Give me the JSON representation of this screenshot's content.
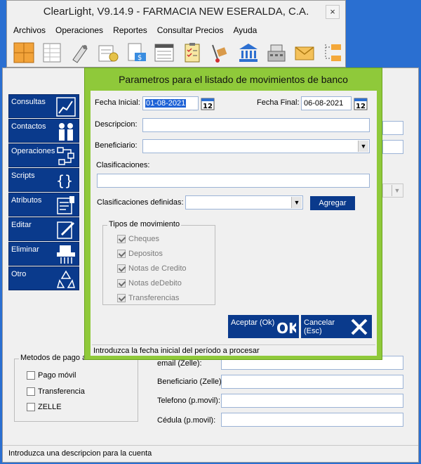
{
  "app": {
    "title": "ClearLight, V9.14.9 - FARMACIA NEW ESERALDA, C.A.",
    "close": "×",
    "menu": [
      "Archivos",
      "Operaciones",
      "Reportes",
      "Consultar Precios",
      "Ayuda"
    ],
    "toolbar_icons": [
      "grid-orange-icon",
      "spreadsheet-icon",
      "pen-icon",
      "ledger-icon",
      "invoice-dollar-icon",
      "document-list-icon",
      "checklist-icon",
      "hand-truck-icon",
      "bank-icon",
      "cash-register-icon",
      "envelope-icon",
      "folders-icon"
    ]
  },
  "background_form": {
    "side_menu": [
      {
        "label": "Consultas",
        "icon": "chart-icon"
      },
      {
        "label": "Contactos",
        "icon": "people-icon"
      },
      {
        "label": "Operaciones",
        "icon": "flow-icon"
      },
      {
        "label": "Scripts",
        "icon": "braces-icon"
      },
      {
        "label": "Atributos",
        "icon": "attributes-icon"
      },
      {
        "label": "Editar",
        "icon": "edit-icon"
      },
      {
        "label": "Eliminar",
        "icon": "shredder-icon"
      },
      {
        "label": "Otro",
        "icon": "recycle-icon"
      }
    ],
    "metodos": {
      "legend": "Metodos de pago a",
      "options": [
        "Pago móvil",
        "Transferencia",
        "ZELLE"
      ]
    },
    "labels": {
      "email": "email (Zelle):",
      "beneficiario": "Beneficiario (Zelle):",
      "telefono": "Telefono (p.movil):",
      "cedula": "Cédula (p.movil):"
    },
    "status": "Introduzca una descripcion para la cuenta"
  },
  "dialog": {
    "title": "Parametros para el listado de movimientos de banco",
    "fecha_inicial_label": "Fecha Inicial:",
    "fecha_inicial_value": "01-08-2021",
    "fecha_final_label": "Fecha Final:",
    "fecha_final_value": "06-08-2021",
    "calendar_day": "12",
    "descripcion_label": "Descripcion:",
    "descripcion_value": "",
    "beneficiario_label": "Beneficiario:",
    "beneficiario_value": "",
    "clasificaciones_label": "Clasificaciones:",
    "clasificaciones_value": "",
    "clasificaciones_definidas_label": "Clasificaciones definidas:",
    "clasificaciones_definidas_value": "",
    "agregar_label": "Agregar",
    "tipos": {
      "legend": "Tipos de movimiento",
      "items": [
        {
          "label": "Cheques",
          "checked": true
        },
        {
          "label": "Depositos",
          "checked": true
        },
        {
          "label": "Notas de Credito",
          "checked": true
        },
        {
          "label": "Notas deDebito",
          "checked": true
        },
        {
          "label": "Transferencias",
          "checked": true
        }
      ]
    },
    "aceptar_label": "Aceptar (Ok)",
    "aceptar_icon_text": "OK",
    "cancelar_label_1": "Cancelar",
    "cancelar_label_2": "(Esc)",
    "status": "Introduzca la fecha inicial del período a procesar"
  },
  "colors": {
    "dialog_frame": "#8fc93a",
    "button_blue": "#0a3a8c",
    "desktop": "#2a6fd1"
  }
}
